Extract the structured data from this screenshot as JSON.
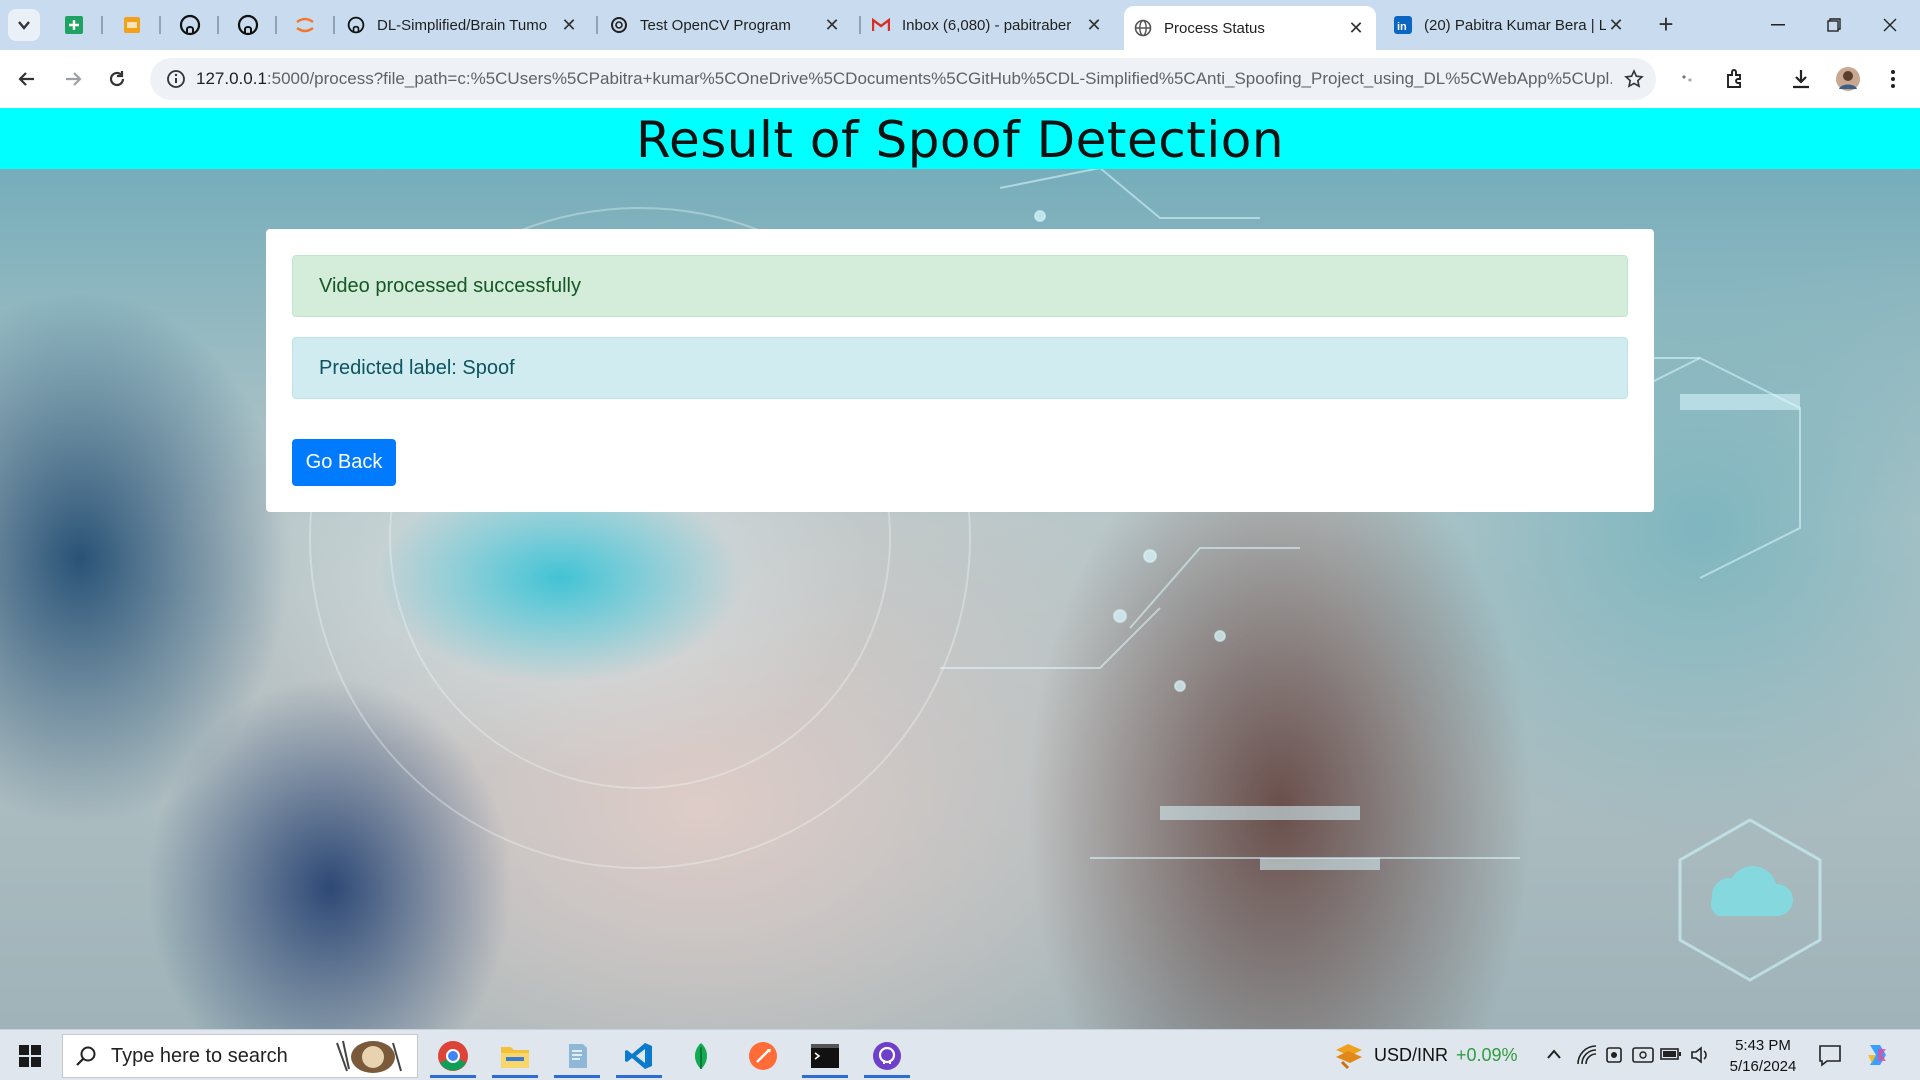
{
  "browser": {
    "tabs": [
      {
        "title": "DL-Simplified/Brain Tumo",
        "icon": "github-icon"
      },
      {
        "title": "Test OpenCV Program",
        "icon": "openai-icon"
      },
      {
        "title": "Inbox (6,080) - pabitraber",
        "icon": "gmail-icon"
      },
      {
        "title": "Process Status",
        "icon": "globe-icon",
        "active": true
      },
      {
        "title": "(20) Pabitra Kumar Bera | L",
        "icon": "linkedin-icon"
      }
    ],
    "url_host": "127.0.0.1",
    "url_rest": ":5000/process?file_path=c:%5CUsers%5CPabitra+kumar%5COneDrive%5CDocuments%5CGitHub%5CDL-Simplified%5CAnti_Spoofing_Project_using_DL%5CWebApp%5CUpl..."
  },
  "page": {
    "title": "Result of Spoof Detection",
    "success_message": "Video processed successfully",
    "prediction_message": "Predicted label: Spoof",
    "back_button": "Go Back",
    "colors": {
      "header": "#00ffff",
      "success_bg": "#d4edda",
      "info_bg": "#d1ecf1",
      "button": "#007bff"
    }
  },
  "taskbar": {
    "search_placeholder": "Type here to search",
    "ticker_label": "USD/INR",
    "ticker_change": "+0.09%",
    "time": "5:43 PM",
    "date": "5/16/2024"
  }
}
